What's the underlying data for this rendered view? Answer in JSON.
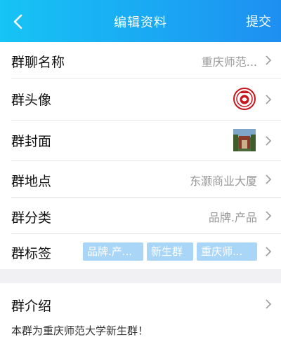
{
  "header": {
    "title": "编辑资料",
    "submit_label": "提交"
  },
  "rows": {
    "name": {
      "label": "群聊名称",
      "value": "重庆师范..."
    },
    "avatar": {
      "label": "群头像"
    },
    "cover": {
      "label": "群封面"
    },
    "location": {
      "label": "群地点",
      "value": "东灏商业大厦"
    },
    "category": {
      "label": "群分类",
      "value": "品牌.产品"
    },
    "tags": {
      "label": "群标签",
      "items": [
        "品牌.产...",
        "新生群",
        "重庆师..."
      ]
    }
  },
  "intro": {
    "label": "群介绍",
    "description": "本群为重庆师范大学新生群！"
  },
  "colors": {
    "header_start": "#16c4f5",
    "header_end": "#1e8ff2",
    "tag_bg": "#a9d5f7"
  }
}
